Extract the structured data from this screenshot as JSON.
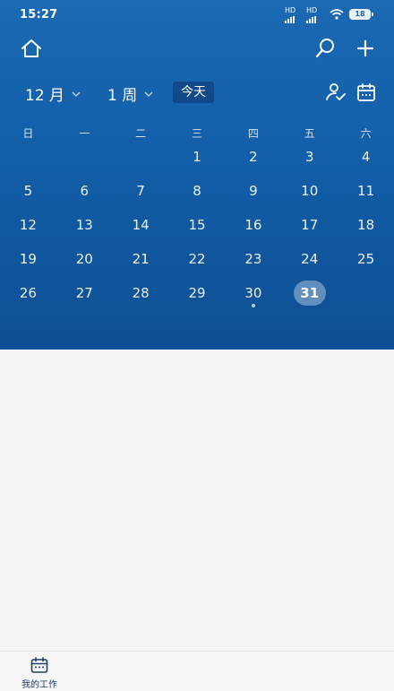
{
  "status_bar": {
    "time": "15:27",
    "signal_labels": [
      "HD",
      "HD"
    ],
    "battery": "18"
  },
  "toolbar": {
    "home_icon": "home-icon",
    "search_icon": "search-icon",
    "add_icon": "plus-icon"
  },
  "selectors": {
    "month": "12 月",
    "week": "1 周",
    "today": "今天",
    "person_icon": "person-check-icon",
    "calendar_icon": "calendar-icon"
  },
  "calendar": {
    "weekdays": [
      "日",
      "一",
      "二",
      "三",
      "四",
      "五",
      "六"
    ],
    "weeks": [
      [
        "",
        "",
        "",
        "1",
        "2",
        "3",
        "4"
      ],
      [
        "5",
        "6",
        "7",
        "8",
        "9",
        "10",
        "11"
      ],
      [
        "12",
        "13",
        "14",
        "15",
        "16",
        "17",
        "18"
      ],
      [
        "19",
        "20",
        "21",
        "22",
        "23",
        "24",
        "25"
      ],
      [
        "26",
        "27",
        "28",
        "29",
        "30",
        "31",
        ""
      ]
    ],
    "selected_day": "31",
    "dot_day": "30"
  },
  "colors": {
    "header_top": "#1c69b3",
    "header_bottom": "#0d4f93",
    "nav_label": "#1f3f66"
  },
  "bottom_nav": {
    "items": [
      {
        "label": "我的工作",
        "icon": "calendar-icon"
      }
    ]
  }
}
